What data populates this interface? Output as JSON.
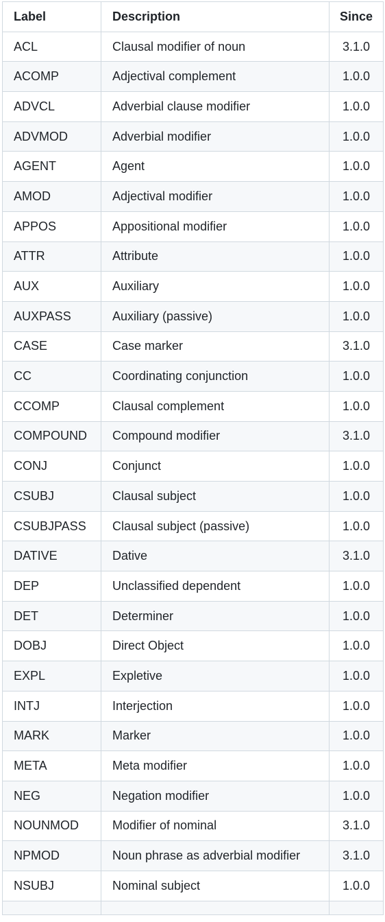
{
  "table": {
    "headers": {
      "label": "Label",
      "description": "Description",
      "since": "Since"
    },
    "rows": [
      {
        "label": "ACL",
        "description": "Clausal modifier of noun",
        "since": "3.1.0"
      },
      {
        "label": "ACOMP",
        "description": "Adjectival complement",
        "since": "1.0.0"
      },
      {
        "label": "ADVCL",
        "description": "Adverbial clause modifier",
        "since": "1.0.0"
      },
      {
        "label": "ADVMOD",
        "description": "Adverbial modifier",
        "since": "1.0.0"
      },
      {
        "label": "AGENT",
        "description": "Agent",
        "since": "1.0.0"
      },
      {
        "label": "AMOD",
        "description": "Adjectival modifier",
        "since": "1.0.0"
      },
      {
        "label": "APPOS",
        "description": "Appositional modifier",
        "since": "1.0.0"
      },
      {
        "label": "ATTR",
        "description": "Attribute",
        "since": "1.0.0"
      },
      {
        "label": "AUX",
        "description": "Auxiliary",
        "since": "1.0.0"
      },
      {
        "label": "AUXPASS",
        "description": "Auxiliary (passive)",
        "since": "1.0.0"
      },
      {
        "label": "CASE",
        "description": "Case marker",
        "since": "3.1.0"
      },
      {
        "label": "CC",
        "description": "Coordinating conjunction",
        "since": "1.0.0"
      },
      {
        "label": "CCOMP",
        "description": "Clausal complement",
        "since": "1.0.0"
      },
      {
        "label": "COMPOUND",
        "description": "Compound modifier",
        "since": "3.1.0"
      },
      {
        "label": "CONJ",
        "description": "Conjunct",
        "since": "1.0.0"
      },
      {
        "label": "CSUBJ",
        "description": "Clausal subject",
        "since": "1.0.0"
      },
      {
        "label": "CSUBJPASS",
        "description": "Clausal subject (passive)",
        "since": "1.0.0"
      },
      {
        "label": "DATIVE",
        "description": "Dative",
        "since": "3.1.0"
      },
      {
        "label": "DEP",
        "description": "Unclassified dependent",
        "since": "1.0.0"
      },
      {
        "label": "DET",
        "description": "Determiner",
        "since": "1.0.0"
      },
      {
        "label": "DOBJ",
        "description": "Direct Object",
        "since": "1.0.0"
      },
      {
        "label": "EXPL",
        "description": "Expletive",
        "since": "1.0.0"
      },
      {
        "label": "INTJ",
        "description": "Interjection",
        "since": "1.0.0"
      },
      {
        "label": "MARK",
        "description": "Marker",
        "since": "1.0.0"
      },
      {
        "label": "META",
        "description": "Meta modifier",
        "since": "1.0.0"
      },
      {
        "label": "NEG",
        "description": "Negation modifier",
        "since": "1.0.0"
      },
      {
        "label": "NOUNMOD",
        "description": "Modifier of nominal",
        "since": "3.1.0"
      },
      {
        "label": "NPMOD",
        "description": "Noun phrase as adverbial modifier",
        "since": "3.1.0"
      },
      {
        "label": "NSUBJ",
        "description": "Nominal subject",
        "since": "1.0.0"
      }
    ]
  }
}
